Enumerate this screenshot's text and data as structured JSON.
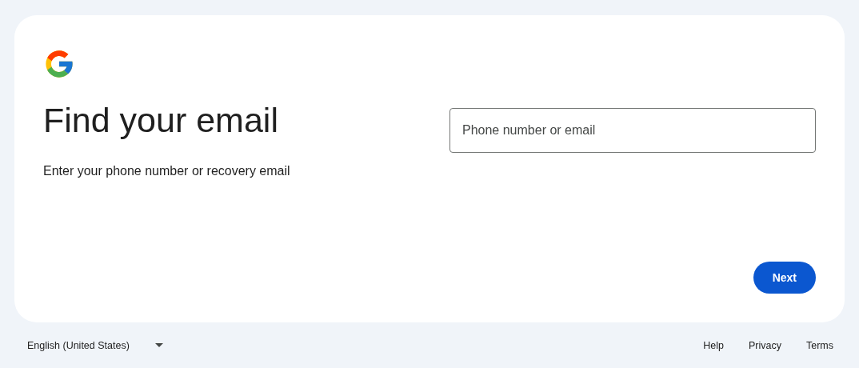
{
  "heading": "Find your email",
  "subtitle": "Enter your phone number or recovery email",
  "field": {
    "placeholder": "Phone number or email"
  },
  "next_button": "Next",
  "footer": {
    "language": "English (United States)",
    "links": [
      "Help",
      "Privacy",
      "Terms"
    ]
  }
}
